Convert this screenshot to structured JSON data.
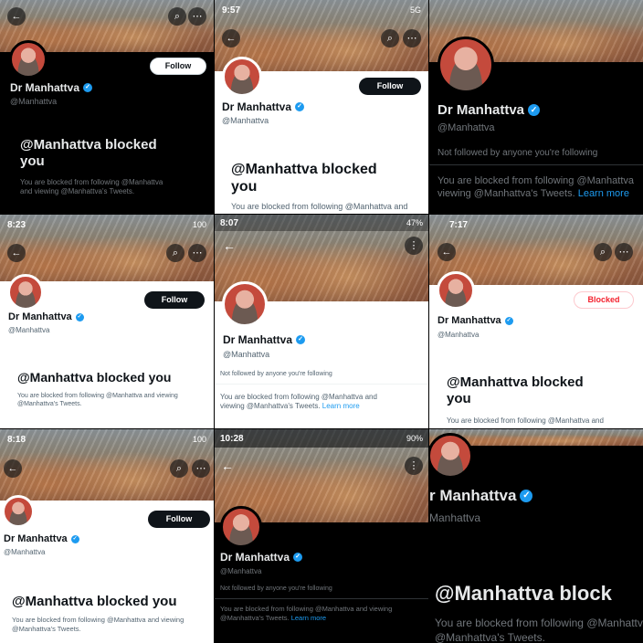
{
  "profile": {
    "name": "Dr Manhattva",
    "handle": "@Manhattva",
    "blocked_headline": "@Manhattva blocked you",
    "blocked_headline_line1": "@Manhattva blocked",
    "blocked_headline_line2": "you",
    "blocked_desc": "You are blocked from following @Manhattva and viewing @Manhattva's Tweets.",
    "blocked_desc_line1": "You are blocked from following @Manhattva and viewing",
    "blocked_desc_line2": "@Manhattva's Tweets.",
    "blocked_desc_short": "You are blocked from following @Manhattva",
    "blocked_desc_cut": "You are blocked from following @Manhattva and",
    "blocked_desc_big1": "You are blocked from following @Manhattva",
    "not_followed": "Not followed by anyone you're following",
    "learn_more": "Learn more",
    "headline_cut": "@Manhattva block",
    "name_cut": "r Manhattva",
    "handle_cut": "Manhattva"
  },
  "buttons": {
    "follow": "Follow",
    "blocked": "Blocked"
  },
  "status": {
    "t2_time": "9:57",
    "t2_right": "5G",
    "t4_time": "8:23",
    "t4_right": "100",
    "t5_time": "8:07",
    "t5_right": "47%",
    "t6_time": "7:17",
    "t7_time": "8:18",
    "t7_right": "100",
    "t8_time": "10:28",
    "t8_right": "90%"
  },
  "icons": {
    "back": "←",
    "search": "⌕",
    "more": "⋯",
    "more_vertical": "⋮",
    "verified": "✓"
  },
  "colors": {
    "accent": "#1d9bf0",
    "blocked_red": "#f4212e"
  }
}
